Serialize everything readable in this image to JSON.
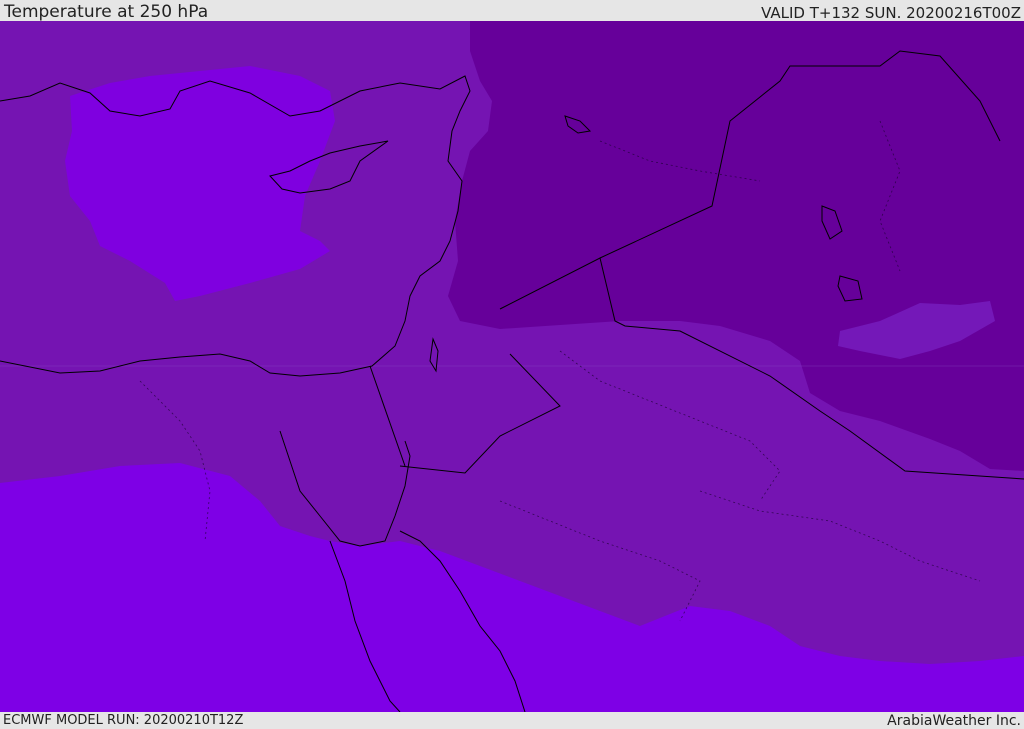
{
  "header": {
    "title": "Temperature at 250 hPa",
    "valid": "VALID T+132 SUN. 20200216T00Z"
  },
  "footer": {
    "model_run": "ECMWF MODEL RUN: 20200210T12Z",
    "brand": "ArabiaWeather Inc."
  },
  "map": {
    "colors": {
      "coldest": "#650096",
      "cold": "#7818b8",
      "mid": "#8a00da",
      "warm": "#7700dd",
      "bright": "#8000ff",
      "coastline": "#000000"
    }
  }
}
